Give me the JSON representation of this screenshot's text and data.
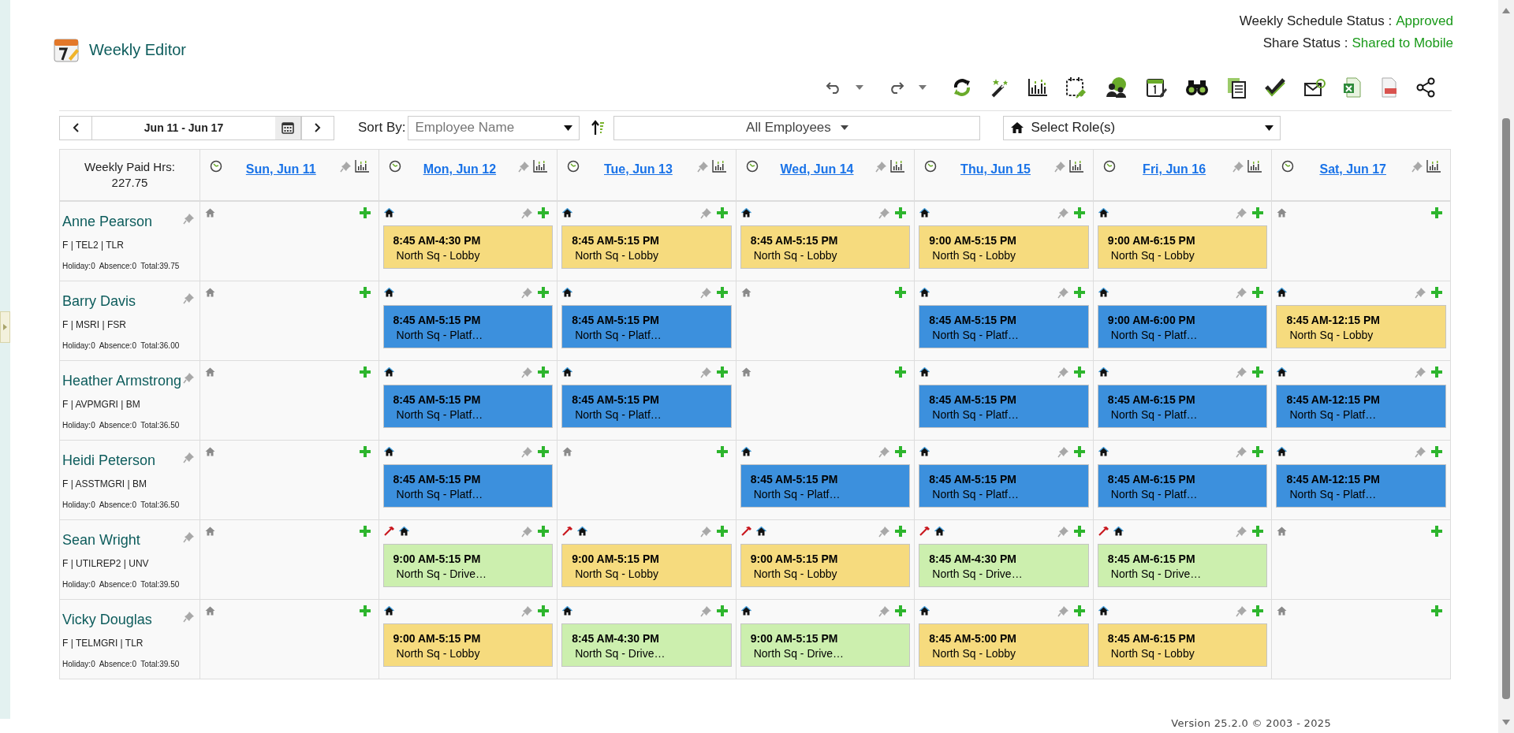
{
  "app": {
    "title": "Weekly Editor"
  },
  "status": [
    {
      "label": "Weekly Schedule Status :",
      "value": "Approved"
    },
    {
      "label": "Share Status :",
      "value": "Shared to Mobile"
    }
  ],
  "filters": {
    "date_range": "Jun 11 - Jun 17",
    "sort_label": "Sort By:",
    "sort_value": "Employee Name",
    "employees": "All Employees",
    "roles_placeholder": "Select Role(s)"
  },
  "grid": {
    "paid_hours_label": "Weekly Paid Hrs:",
    "paid_hours": "227.75",
    "days": [
      "Sun, Jun 11",
      "Mon, Jun 12",
      "Tue, Jun 13",
      "Wed, Jun 14",
      "Thu, Jun 15",
      "Fri, Jun 16",
      "Sat, Jun 17"
    ],
    "employees": [
      {
        "name": "Anne Pearson",
        "info": "F | TEL2 | TLR",
        "totals": "Holiday:0  Absence:0  Total:39.75",
        "cells": [
          {
            "tool_marker": false
          },
          {
            "tool_marker": false,
            "shift": {
              "time": "8:45 AM-4:30 PM",
              "location": "North Sq - Lobby",
              "color": "#f6db7e"
            }
          },
          {
            "tool_marker": false,
            "shift": {
              "time": "8:45 AM-5:15 PM",
              "location": "North Sq - Lobby",
              "color": "#f6db7e"
            }
          },
          {
            "tool_marker": false,
            "shift": {
              "time": "8:45 AM-5:15 PM",
              "location": "North Sq - Lobby",
              "color": "#f6db7e"
            }
          },
          {
            "tool_marker": false,
            "shift": {
              "time": "9:00 AM-5:15 PM",
              "location": "North Sq - Lobby",
              "color": "#f6db7e"
            }
          },
          {
            "tool_marker": false,
            "shift": {
              "time": "9:00 AM-6:15 PM",
              "location": "North Sq - Lobby",
              "color": "#f6db7e"
            }
          },
          {
            "tool_marker": false
          }
        ]
      },
      {
        "name": "Barry Davis",
        "info": "F | MSRI | FSR",
        "totals": "Holiday:0  Absence:0  Total:36.00",
        "cells": [
          {
            "tool_marker": false
          },
          {
            "tool_marker": false,
            "shift": {
              "time": "8:45 AM-5:15 PM",
              "location": "North Sq - Platf…",
              "color": "#3c90dd"
            }
          },
          {
            "tool_marker": false,
            "shift": {
              "time": "8:45 AM-5:15 PM",
              "location": "North Sq - Platf…",
              "color": "#3c90dd"
            }
          },
          {
            "tool_marker": false
          },
          {
            "tool_marker": false,
            "shift": {
              "time": "8:45 AM-5:15 PM",
              "location": "North Sq - Platf…",
              "color": "#3c90dd"
            }
          },
          {
            "tool_marker": false,
            "shift": {
              "time": "9:00 AM-6:00 PM",
              "location": "North Sq - Platf…",
              "color": "#3c90dd"
            }
          },
          {
            "tool_marker": false,
            "shift": {
              "time": "8:45 AM-12:15 PM",
              "location": "North Sq - Lobby",
              "color": "#f6db7e"
            }
          }
        ]
      },
      {
        "name": "Heather Armstrong",
        "info": "F | AVPMGRI | BM",
        "totals": "Holiday:0  Absence:0  Total:36.50",
        "cells": [
          {
            "tool_marker": false
          },
          {
            "tool_marker": false,
            "shift": {
              "time": "8:45 AM-5:15 PM",
              "location": "North Sq - Platf…",
              "color": "#3c90dd"
            }
          },
          {
            "tool_marker": false,
            "shift": {
              "time": "8:45 AM-5:15 PM",
              "location": "North Sq - Platf…",
              "color": "#3c90dd"
            }
          },
          {
            "tool_marker": false
          },
          {
            "tool_marker": false,
            "shift": {
              "time": "8:45 AM-5:15 PM",
              "location": "North Sq - Platf…",
              "color": "#3c90dd"
            }
          },
          {
            "tool_marker": false,
            "shift": {
              "time": "8:45 AM-6:15 PM",
              "location": "North Sq - Platf…",
              "color": "#3c90dd"
            }
          },
          {
            "tool_marker": false,
            "shift": {
              "time": "8:45 AM-12:15 PM",
              "location": "North Sq - Platf…",
              "color": "#3c90dd"
            }
          }
        ]
      },
      {
        "name": "Heidi Peterson",
        "info": "F | ASSTMGRI | BM",
        "totals": "Holiday:0  Absence:0  Total:36.50",
        "cells": [
          {
            "tool_marker": false
          },
          {
            "tool_marker": false,
            "shift": {
              "time": "8:45 AM-5:15 PM",
              "location": "North Sq - Platf…",
              "color": "#3c90dd"
            }
          },
          {
            "tool_marker": false
          },
          {
            "tool_marker": false,
            "shift": {
              "time": "8:45 AM-5:15 PM",
              "location": "North Sq - Platf…",
              "color": "#3c90dd"
            }
          },
          {
            "tool_marker": false,
            "shift": {
              "time": "8:45 AM-5:15 PM",
              "location": "North Sq - Platf…",
              "color": "#3c90dd"
            }
          },
          {
            "tool_marker": false,
            "shift": {
              "time": "8:45 AM-6:15 PM",
              "location": "North Sq - Platf…",
              "color": "#3c90dd"
            }
          },
          {
            "tool_marker": false,
            "shift": {
              "time": "8:45 AM-12:15 PM",
              "location": "North Sq - Platf…",
              "color": "#3c90dd"
            }
          }
        ]
      },
      {
        "name": "Sean Wright",
        "info": "F | UTILREP2 | UNV",
        "totals": "Holiday:0  Absence:0  Total:39.50",
        "cells": [
          {
            "tool_marker": false
          },
          {
            "tool_marker": true,
            "shift": {
              "time": "9:00 AM-5:15 PM",
              "location": "North Sq - Drive…",
              "color": "#ccefae"
            }
          },
          {
            "tool_marker": true,
            "shift": {
              "time": "9:00 AM-5:15 PM",
              "location": "North Sq - Lobby",
              "color": "#f6db7e"
            }
          },
          {
            "tool_marker": true,
            "shift": {
              "time": "9:00 AM-5:15 PM",
              "location": "North Sq - Lobby",
              "color": "#f6db7e"
            }
          },
          {
            "tool_marker": true,
            "shift": {
              "time": "8:45 AM-4:30 PM",
              "location": "North Sq - Drive…",
              "color": "#ccefae"
            }
          },
          {
            "tool_marker": true,
            "shift": {
              "time": "8:45 AM-6:15 PM",
              "location": "North Sq - Drive…",
              "color": "#ccefae"
            }
          },
          {
            "tool_marker": false
          }
        ]
      },
      {
        "name": "Vicky Douglas",
        "info": "F | TELMGRI | TLR",
        "totals": "Holiday:0  Absence:0  Total:39.50",
        "cells": [
          {
            "tool_marker": false
          },
          {
            "tool_marker": false,
            "shift": {
              "time": "9:00 AM-5:15 PM",
              "location": "North Sq - Lobby",
              "color": "#f6db7e"
            }
          },
          {
            "tool_marker": false,
            "shift": {
              "time": "8:45 AM-4:30 PM",
              "location": "North Sq - Drive…",
              "color": "#ccefae"
            }
          },
          {
            "tool_marker": false,
            "shift": {
              "time": "9:00 AM-5:15 PM",
              "location": "North Sq - Drive…",
              "color": "#ccefae"
            }
          },
          {
            "tool_marker": false,
            "shift": {
              "time": "8:45 AM-5:00 PM",
              "location": "North Sq - Lobby",
              "color": "#f6db7e"
            }
          },
          {
            "tool_marker": false,
            "shift": {
              "time": "8:45 AM-6:15 PM",
              "location": "North Sq - Lobby",
              "color": "#f6db7e"
            }
          },
          {
            "tool_marker": false
          }
        ]
      }
    ]
  },
  "footer": {
    "version": "Version 25.2.0 © 2003 - 2025"
  }
}
